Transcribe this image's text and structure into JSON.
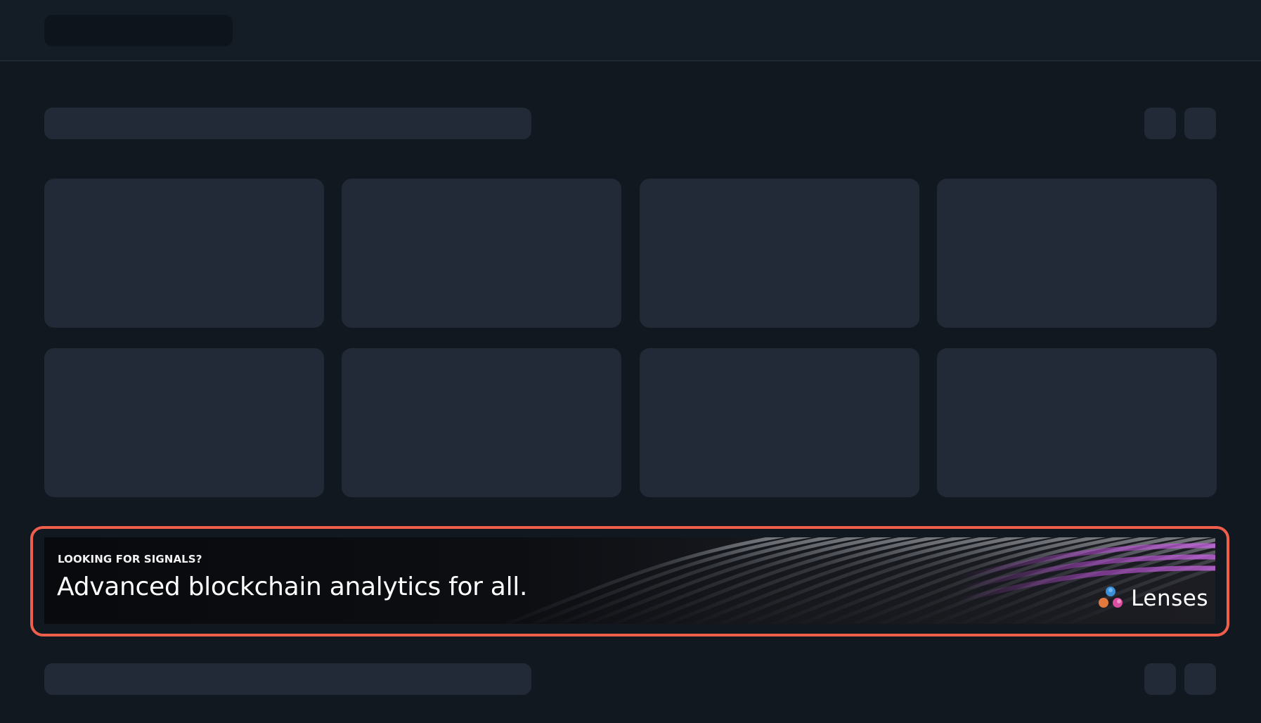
{
  "ad_banner": {
    "kicker": "LOOKING FOR SIGNALS?",
    "headline": "Advanced blockchain analytics for all.",
    "brand_name": "Lenses",
    "logo_icon": "lenses-logo-icon",
    "highlight_color": "#ef5f4c"
  },
  "colors": {
    "background": "#111820",
    "skeleton": "#212a36",
    "accent_wave": "#b54bd0"
  }
}
